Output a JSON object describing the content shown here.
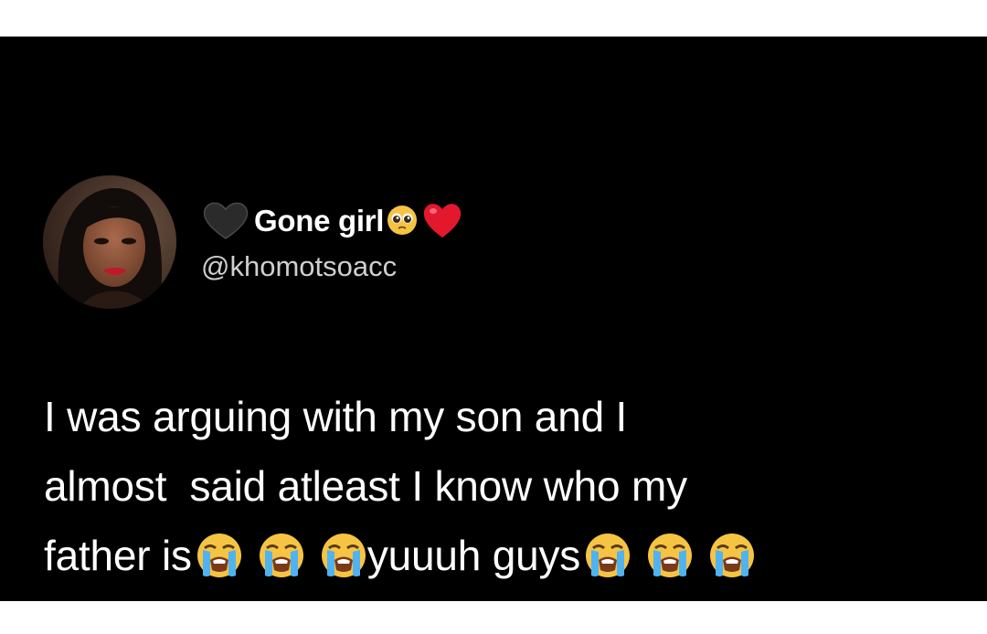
{
  "tweet": {
    "author": {
      "display_name": "Gone girl",
      "handle": "@khomotsoacc",
      "name_emojis": [
        "black-heart-icon",
        "pleading-face-icon",
        "red-heart-icon"
      ]
    },
    "text_lines": [
      "I was arguing with my son and I",
      "almost  said atleast I know who my",
      "father is",
      "yuuuh guys"
    ],
    "inline_emojis": [
      "loudly-crying-face-icon"
    ]
  },
  "colors": {
    "background": "#000000",
    "text": "#ffffff",
    "handle": "#cfcfcf",
    "frame": "#ffffff"
  }
}
